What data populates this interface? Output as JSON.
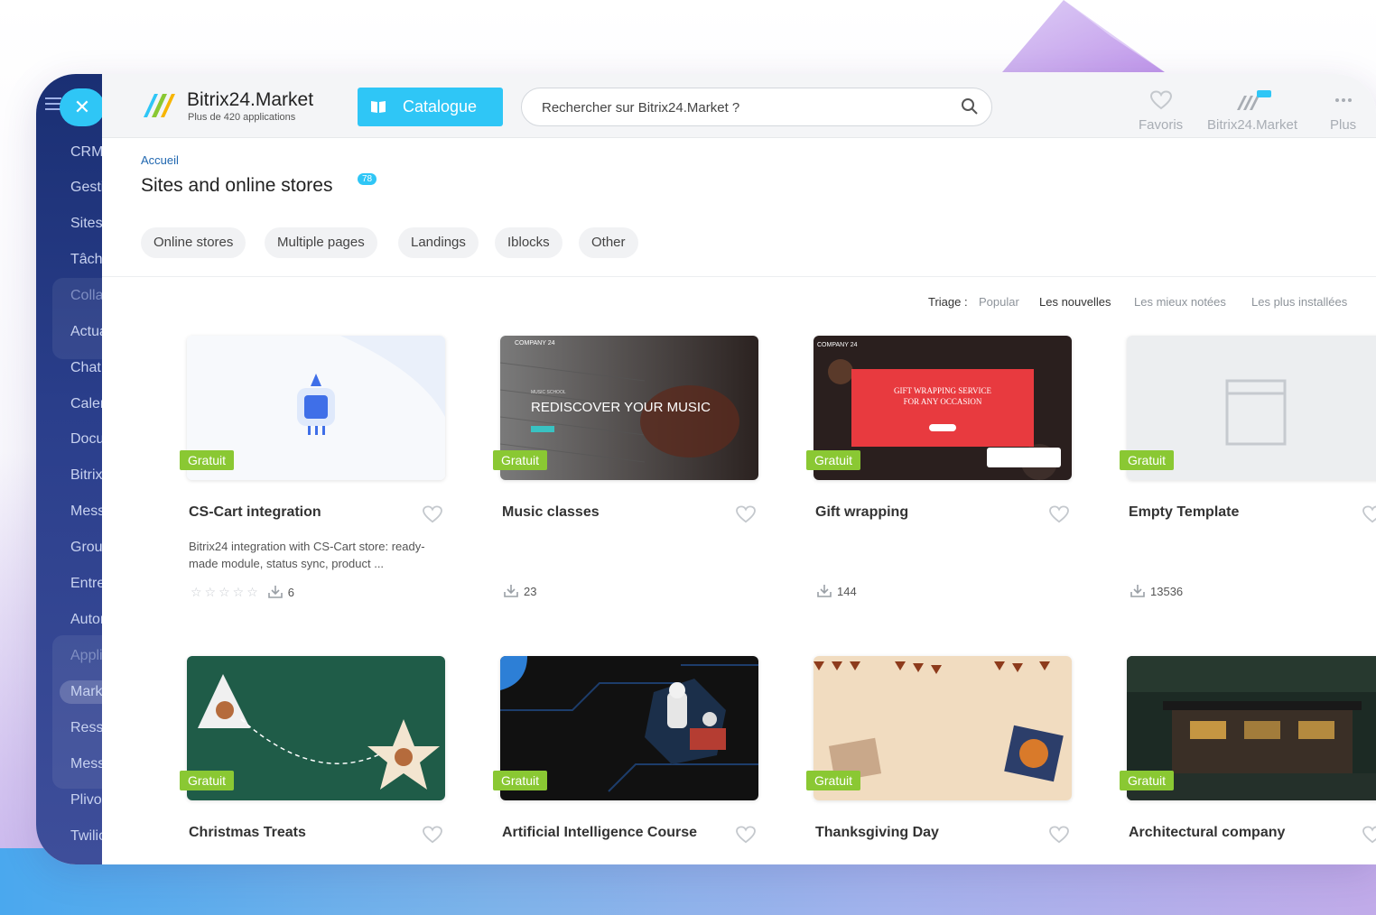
{
  "sidebar": {
    "items": [
      {
        "label": "CRM",
        "muted": false
      },
      {
        "label": "Gestion",
        "muted": false
      },
      {
        "label": "Sites",
        "muted": false
      },
      {
        "label": "Tâches",
        "muted": false
      },
      {
        "label": "Collaboration",
        "muted": true
      },
      {
        "label": "Actualités",
        "muted": false
      },
      {
        "label": "Chat",
        "muted": false
      },
      {
        "label": "Calendrier",
        "muted": false
      },
      {
        "label": "Documents",
        "muted": false
      },
      {
        "label": "Bitrix",
        "muted": false
      },
      {
        "label": "Messagerie",
        "muted": false
      },
      {
        "label": "Groupes",
        "muted": false
      },
      {
        "label": "Entreprise",
        "muted": false
      },
      {
        "label": "Automatisation",
        "muted": false
      },
      {
        "label": "Applications",
        "muted": true
      },
      {
        "label": "Market",
        "muted": false
      },
      {
        "label": "Ressources",
        "muted": false
      },
      {
        "label": "Messages",
        "muted": false
      },
      {
        "label": "Plivo",
        "muted": false
      },
      {
        "label": "Twilio",
        "muted": false
      }
    ]
  },
  "header": {
    "logo_title": "Bitrix24.Market",
    "logo_subtitle": "Plus de 420 applications",
    "catalogue_label": "Catalogue",
    "search_placeholder": "Rechercher sur Bitrix24.Market ?",
    "actions": [
      {
        "label": "Favoris",
        "icon": "heart-icon"
      },
      {
        "label": "Bitrix24.Market",
        "icon": "market-logo-icon"
      },
      {
        "label": "Plus",
        "icon": "more-dots-icon"
      }
    ]
  },
  "breadcrumb": "Accueil",
  "page_title": "Sites and online stores",
  "page_count": "78",
  "filters": [
    "Online stores",
    "Multiple pages",
    "Landings",
    "Iblocks",
    "Other"
  ],
  "sort": {
    "label": "Triage :",
    "options": [
      {
        "label": "Popular",
        "active": false
      },
      {
        "label": "Les nouvelles",
        "active": true
      },
      {
        "label": "Les mieux notées",
        "active": false
      },
      {
        "label": "Les plus installées",
        "active": false
      }
    ]
  },
  "cards": [
    {
      "title": "CS-Cart integration",
      "tag": "Gratuit",
      "description": "Bitrix24 integration with CS-Cart store: ready-made module, status sync, product ...",
      "installs": "6",
      "has_rating": true
    },
    {
      "title": "Music classes",
      "tag": "Gratuit",
      "installs": "23",
      "thumb_text": "REDISCOVER YOUR MUSIC",
      "thumb_brand": "COMPANY 24",
      "thumb_small": "MUSIC SCHOOL"
    },
    {
      "title": "Gift wrapping",
      "tag": "Gratuit",
      "installs": "144",
      "thumb_text": "GIFT WRAPPING SERVICE FOR ANY OCCASION",
      "thumb_brand": "COMPANY 24"
    },
    {
      "title": "Empty Template",
      "tag": "Gratuit",
      "installs": "13536"
    },
    {
      "title": "Christmas Treats",
      "tag": "Gratuit"
    },
    {
      "title": "Artificial Intelligence Course",
      "tag": "Gratuit"
    },
    {
      "title": "Thanksgiving Day",
      "tag": "Gratuit"
    },
    {
      "title": "Architectural company",
      "tag": "Gratuit"
    }
  ],
  "colors": {
    "accent": "#2fc6f6",
    "free_tag": "#8ac833",
    "sidebar": "#1f3378",
    "link": "#2067b0"
  }
}
